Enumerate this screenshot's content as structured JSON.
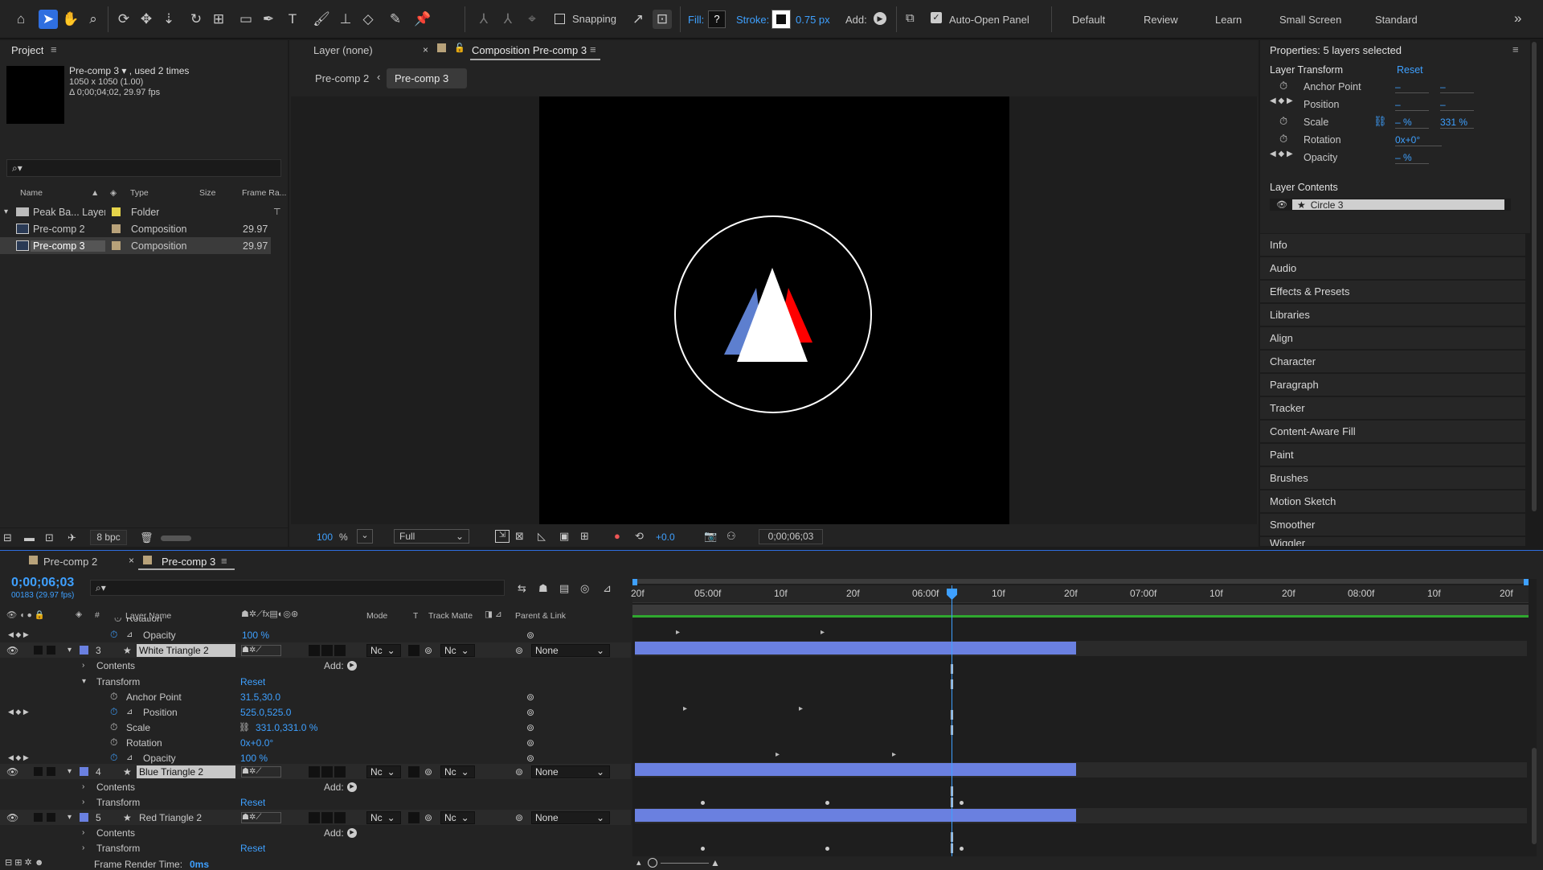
{
  "toolbar": {
    "snapping": "Snapping",
    "fill_label": "Fill:",
    "fill_value": "?",
    "stroke_label": "Stroke:",
    "stroke_value": "0.75 px",
    "add_label": "Add:",
    "auto_open": "Auto-Open Panel",
    "workspaces": [
      "Default",
      "Review",
      "Learn",
      "Small Screen",
      "Standard"
    ],
    "more": "»"
  },
  "project": {
    "title": "Project",
    "info_name": "Pre-comp 3 ▾ , used 2 times",
    "info_size": "1050 x 1050 (1.00)",
    "info_dur": "Δ 0;00;04;02, 29.97 fps",
    "search_placeholder": "",
    "columns": {
      "name": "Name",
      "type": "Type",
      "size": "Size",
      "fps": "Frame Ra..."
    },
    "items": [
      {
        "name": "Peak Ba... Layers",
        "type": "Folder",
        "fps": "",
        "color": "#e6d44a"
      },
      {
        "name": "Pre-comp 2",
        "type": "Composition",
        "fps": "29.97",
        "color": "#b8a27a"
      },
      {
        "name": "Pre-comp 3",
        "type": "Composition",
        "fps": "29.97",
        "color": "#b8a27a"
      }
    ],
    "bpc": "8 bpc"
  },
  "viewer": {
    "tab_layer": "Layer (none)",
    "tab_comp": "Composition Pre-comp 3",
    "crumbs": [
      "Pre-comp 2",
      "Pre-comp 3"
    ],
    "zoom": "100",
    "zoom_unit": "%",
    "resolution": "Full",
    "exposure": "+0.0",
    "timecode": "0;00;06;03"
  },
  "properties": {
    "title": "Properties: 5 layers selected",
    "section_transform": "Layer Transform",
    "reset": "Reset",
    "rows": [
      {
        "label": "Anchor Point",
        "v1": "–",
        "v2": "–"
      },
      {
        "label": "Position",
        "v1": "–",
        "v2": "–"
      },
      {
        "label": "Scale",
        "v1": "– %",
        "v2": "331 %"
      },
      {
        "label": "Rotation",
        "v1": "0x+0°",
        "v2": ""
      },
      {
        "label": "Opacity",
        "v1": "– %",
        "v2": ""
      }
    ],
    "section_contents": "Layer Contents",
    "content_item": "Circle 3"
  },
  "right_panels": [
    "Info",
    "Audio",
    "Effects & Presets",
    "Libraries",
    "Align",
    "Character",
    "Paragraph",
    "Tracker",
    "Content-Aware Fill",
    "Paint",
    "Brushes",
    "Motion Sketch",
    "Smoother",
    "Wiggler"
  ],
  "timeline": {
    "tab1": "Pre-comp 2",
    "tab2": "Pre-comp 3",
    "timecode": "0;00;06;03",
    "frames": "00183 (29.97 fps)",
    "headers": {
      "num": "#",
      "layer_name": "Layer Name",
      "mode": "Mode",
      "t": "T",
      "track_matte": "Track Matte",
      "parent": "Parent & Link"
    },
    "ruler": [
      "20f",
      "05:00f",
      "10f",
      "20f",
      "06:00f",
      "10f",
      "20f",
      "07:00f",
      "10f",
      "20f",
      "08:00f",
      "10f",
      "20f"
    ],
    "rows": {
      "rotation_cut": "Rotation",
      "opacity_top_label": "Opacity",
      "opacity_top_value": "100 %",
      "layer3_num": "3",
      "layer3_name": "White Triangle 2",
      "contents": "Contents",
      "add": "Add:",
      "transform": "Transform",
      "reset": "Reset",
      "anchor": "Anchor Point",
      "anchor_value": "31.5,30.0",
      "position": "Position",
      "position_value": "525.0,525.0",
      "scale": "Scale",
      "scale_value": "331.0,331.0 %",
      "rotation": "Rotation",
      "rotation_value": "0x+0.0°",
      "opacity": "Opacity",
      "opacity_value": "100 %",
      "layer4_num": "4",
      "layer4_name": "Blue Triangle 2",
      "layer5_num": "5",
      "layer5_name": "Red Triangle 2",
      "mode_value": "Nc",
      "matte_value": "Nc",
      "parent_value": "None"
    },
    "footer_label": "Frame Render Time:",
    "footer_value": "0ms"
  }
}
